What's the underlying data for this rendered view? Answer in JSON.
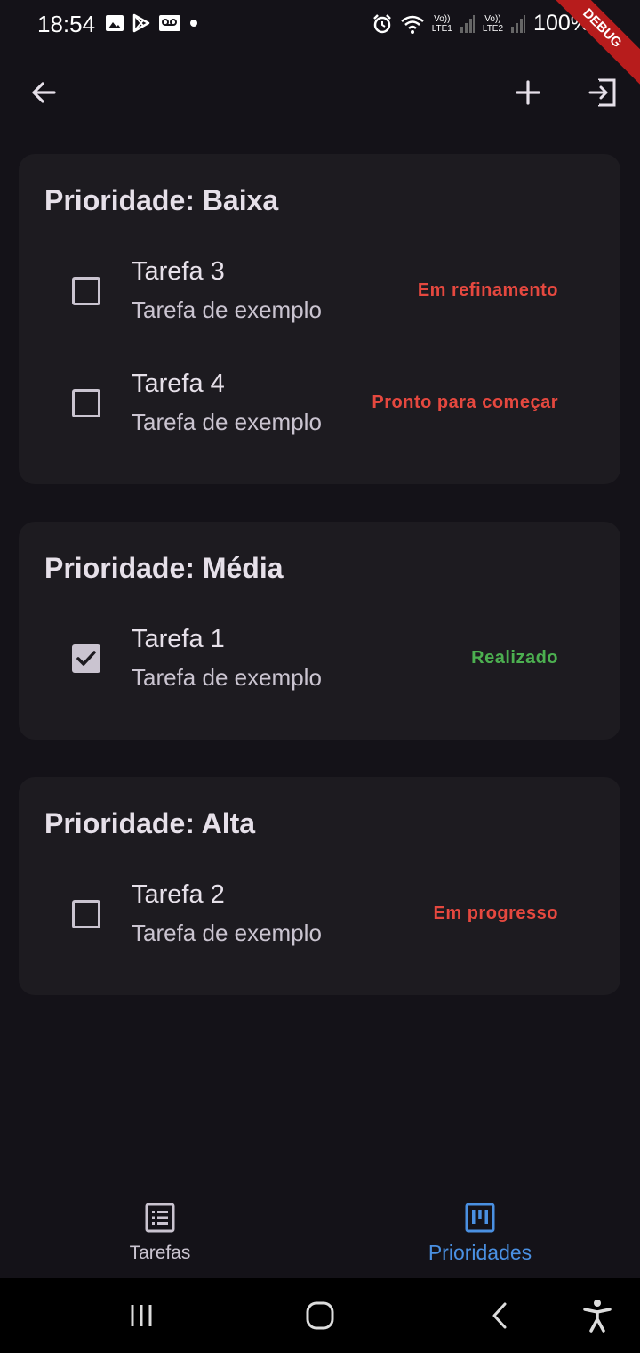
{
  "status_bar": {
    "time": "18:54",
    "battery": "100%",
    "debug_banner": "DEBUG",
    "lte1": "LTE1",
    "lte2": "LTE2",
    "volte": "Vo))"
  },
  "app_bar": {
    "back_icon": "arrow-left-icon",
    "add_icon": "plus-icon",
    "logout_icon": "logout-icon"
  },
  "groups": [
    {
      "title": "Prioridade: Baixa",
      "tasks": [
        {
          "title": "Tarefa 3",
          "subtitle": "Tarefa de exemplo",
          "status": "Em refinamento",
          "status_color": "#e5483f",
          "checked": false
        },
        {
          "title": "Tarefa 4",
          "subtitle": "Tarefa de exemplo",
          "status": "Pronto para começar",
          "status_color": "#e5483f",
          "checked": false
        }
      ]
    },
    {
      "title": "Prioridade: Média",
      "tasks": [
        {
          "title": "Tarefa 1",
          "subtitle": "Tarefa de exemplo",
          "status": "Realizado",
          "status_color": "#4caf50",
          "checked": true
        }
      ]
    },
    {
      "title": "Prioridade: Alta",
      "tasks": [
        {
          "title": "Tarefa 2",
          "subtitle": "Tarefa de exemplo",
          "status": "Em progresso",
          "status_color": "#e5483f",
          "checked": false
        }
      ]
    }
  ],
  "bottom_nav": {
    "items": [
      {
        "label": "Tarefas",
        "icon": "list-icon",
        "active": false
      },
      {
        "label": "Prioridades",
        "icon": "kanban-icon",
        "active": true
      }
    ],
    "active_color": "#4a90e2",
    "inactive_color": "#cac4d0"
  },
  "colors": {
    "background": "#141218",
    "card": "#1d1b20",
    "danger": "#e5483f",
    "success": "#4caf50",
    "accent": "#4a90e2"
  }
}
